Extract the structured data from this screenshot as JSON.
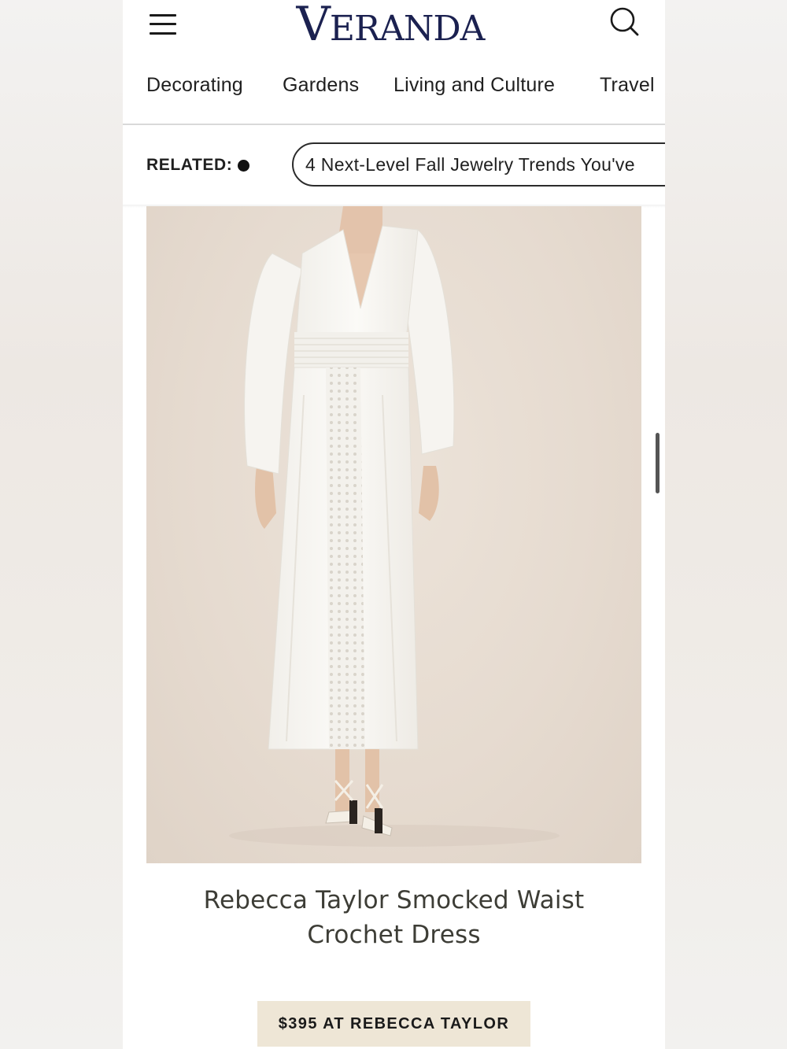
{
  "header": {
    "logo_initial": "V",
    "logo_rest": "ERANDA",
    "menu_icon": "hamburger-menu-icon",
    "search_icon": "search-icon"
  },
  "nav": {
    "items": [
      {
        "label": "Decorating"
      },
      {
        "label": "Gardens"
      },
      {
        "label": "Living and Culture"
      },
      {
        "label": "Travel"
      }
    ]
  },
  "related": {
    "label": "RELATED:",
    "link_text": "4 Next-Level Fall Jewelry Trends You've"
  },
  "product": {
    "title": "Rebecca Taylor Smocked Waist Crochet Dress",
    "buy_label": "$395 AT REBECCA TAYLOR",
    "image_subject": "model wearing white long-sleeve v-neck midi dress with crochet panel and strappy sandals"
  },
  "colors": {
    "logo": "#1b2150",
    "image_background": "#e6dbd0",
    "buy_button_background": "#eee6d6",
    "title_text": "#3d3d36"
  }
}
